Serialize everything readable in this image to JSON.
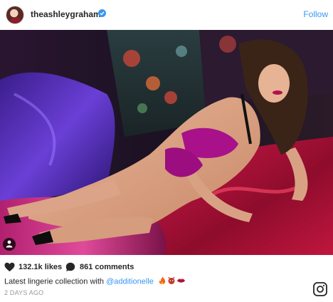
{
  "post": {
    "username": "theashleygraham",
    "follow_label": "Follow",
    "likes": "132.1k likes",
    "comments": "861 comments",
    "caption_text": "Latest lingerie collection with ",
    "caption_mention": "@additionelle",
    "timestamp": "2 DAYS AGO"
  },
  "icons": {
    "verified": "verified-badge-icon",
    "heart": "heart-icon",
    "comment": "comment-bubble-icon",
    "tag": "user-tag-icon",
    "logo": "instagram-logo-icon",
    "emojis": [
      "fire-emoji",
      "devil-emoji",
      "lips-emoji"
    ]
  },
  "colors": {
    "link": "#3897f0",
    "text": "#262626",
    "muted": "#999999"
  }
}
